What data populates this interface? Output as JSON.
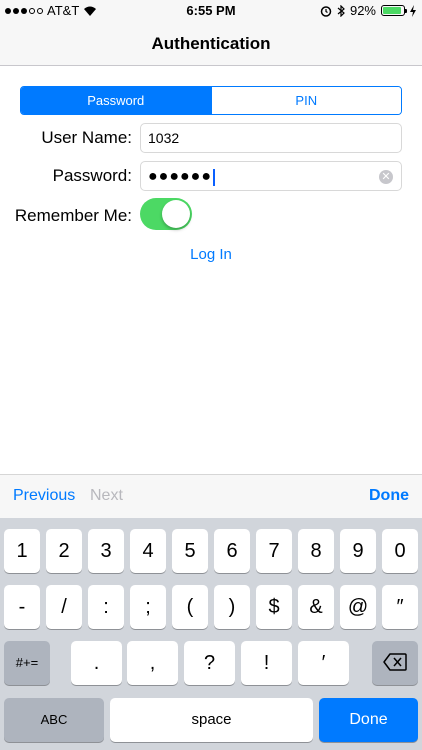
{
  "status_bar": {
    "carrier": "AT&T",
    "time": "6:55 PM",
    "battery_percent": "92%",
    "battery_level": 0.92
  },
  "nav": {
    "title": "Authentication"
  },
  "auth_mode": {
    "segments": [
      "Password",
      "PIN"
    ],
    "selected": "Password"
  },
  "form": {
    "username_label": "User Name:",
    "username_value": "1032",
    "password_label": "Password:",
    "password_masked": "●●●●●●",
    "remember_label": "Remember Me:",
    "remember_on": true,
    "login_label": "Log In"
  },
  "accessory": {
    "previous": "Previous",
    "next": "Next",
    "done": "Done"
  },
  "keyboard": {
    "row1": [
      "1",
      "2",
      "3",
      "4",
      "5",
      "6",
      "7",
      "8",
      "9",
      "0"
    ],
    "row2": [
      "-",
      "/",
      ":",
      ";",
      "(",
      ")",
      "$",
      "&",
      "@",
      "″"
    ],
    "row3": [
      ".",
      ",",
      "?",
      "!",
      "′"
    ],
    "symbols_key": "#+=",
    "abc_key": "ABC",
    "space_key": "space",
    "done_key": "Done",
    "backspace_icon": "backspace-icon"
  },
  "colors": {
    "accent": "#007aff",
    "toggle_on": "#4cd964",
    "keyboard_bg": "#d1d5db"
  }
}
